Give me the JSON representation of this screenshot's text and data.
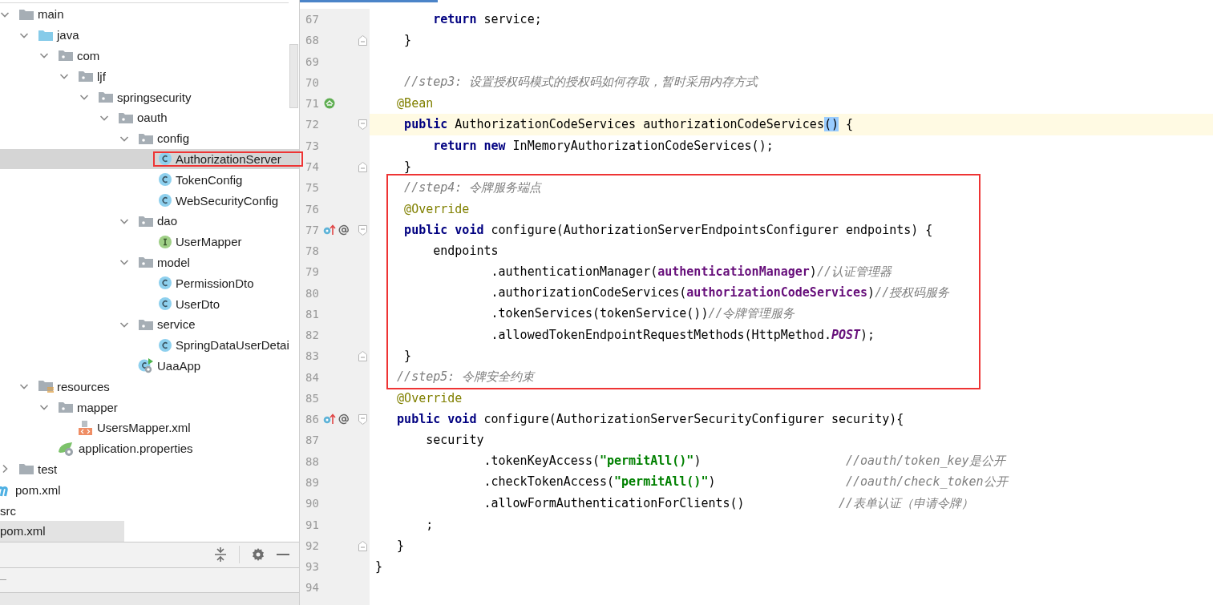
{
  "tree": [
    {
      "label": "main",
      "kind": "folder",
      "expanded": true,
      "selected": false,
      "marked": false,
      "children": [
        {
          "label": "java",
          "kind": "source-folder",
          "expanded": true,
          "selected": false,
          "marked": false,
          "children": [
            {
              "label": "com",
              "kind": "package",
              "expanded": true,
              "selected": false,
              "marked": false,
              "children": [
                {
                  "label": "ljf",
                  "kind": "package",
                  "expanded": true,
                  "selected": false,
                  "marked": false,
                  "children": [
                    {
                      "label": "springsecurity",
                      "kind": "package",
                      "expanded": true,
                      "selected": false,
                      "marked": false,
                      "children": [
                        {
                          "label": "oauth",
                          "kind": "package",
                          "expanded": true,
                          "selected": false,
                          "marked": false,
                          "children": [
                            {
                              "label": "config",
                              "kind": "package",
                              "expanded": true,
                              "selected": false,
                              "marked": false,
                              "children": [
                                {
                                  "label": "AuthorizationServer",
                                  "kind": "class",
                                  "selected": true,
                                  "marked": true
                                },
                                {
                                  "label": "TokenConfig",
                                  "kind": "class",
                                  "selected": false,
                                  "marked": false
                                },
                                {
                                  "label": "WebSecurityConfig",
                                  "kind": "class",
                                  "selected": false,
                                  "marked": false
                                }
                              ]
                            },
                            {
                              "label": "dao",
                              "kind": "package",
                              "expanded": true,
                              "selected": false,
                              "marked": false,
                              "children": [
                                {
                                  "label": "UserMapper",
                                  "kind": "interface",
                                  "selected": false,
                                  "marked": false
                                }
                              ]
                            },
                            {
                              "label": "model",
                              "kind": "package",
                              "expanded": true,
                              "selected": false,
                              "marked": false,
                              "children": [
                                {
                                  "label": "PermissionDto",
                                  "kind": "class",
                                  "selected": false,
                                  "marked": false
                                },
                                {
                                  "label": "UserDto",
                                  "kind": "class",
                                  "selected": false,
                                  "marked": false
                                }
                              ]
                            },
                            {
                              "label": "service",
                              "kind": "package",
                              "expanded": true,
                              "selected": false,
                              "marked": false,
                              "children": [
                                {
                                  "label": "SpringDataUserDetai",
                                  "kind": "class",
                                  "selected": false,
                                  "marked": false
                                }
                              ]
                            },
                            {
                              "label": "UaaApp",
                              "kind": "app",
                              "selected": false,
                              "marked": false
                            }
                          ]
                        }
                      ]
                    }
                  ]
                }
              ]
            }
          ]
        },
        {
          "label": "resources",
          "kind": "resources-folder",
          "expanded": true,
          "selected": false,
          "marked": false,
          "children": [
            {
              "label": "mapper",
              "kind": "package",
              "expanded": true,
              "selected": false,
              "marked": false,
              "children": [
                {
                  "label": "UsersMapper.xml",
                  "kind": "xml",
                  "selected": false,
                  "marked": false
                }
              ]
            },
            {
              "label": "application.properties",
              "kind": "properties",
              "selected": false,
              "marked": false
            }
          ]
        }
      ]
    },
    {
      "label": "test",
      "kind": "folder",
      "expanded": false,
      "selected": false,
      "marked": false
    }
  ],
  "project_items": [
    {
      "label": "pom.xml",
      "kind": "maven",
      "shaded": false
    },
    {
      "label": "src",
      "kind": "plain",
      "shaded": false
    },
    {
      "label": "pom.xml",
      "kind": "plain",
      "shaded": true
    }
  ],
  "code_blocks": [
    {
      "framed": false,
      "lines": [
        {
          "number": "67",
          "code": [
            {
              "kind": "kw",
              "text": "        return"
            },
            {
              "kind": "plain",
              "text": " service;"
            }
          ]
        },
        {
          "number": "68",
          "fold": {
            "kind": "end"
          },
          "code": [
            {
              "kind": "plain",
              "text": "    }"
            }
          ]
        },
        {
          "number": "69"
        },
        {
          "number": "70",
          "code": [
            {
              "kind": "comment",
              "text": "    //step3: 设置授权码模式的授权码如何存取，暂时采用内存方式"
            }
          ]
        },
        {
          "number": "71",
          "gutter_icons": [
            {
              "kind": "bean"
            }
          ],
          "code": [
            {
              "kind": "anno",
              "text": "   @Bean"
            }
          ]
        },
        {
          "number": "72",
          "current": true,
          "fold": {
            "kind": "start"
          },
          "code": [
            {
              "kind": "kw",
              "text": "    public"
            },
            {
              "kind": "plain",
              "text": " AuthorizationCodeServices authorizationCodeServices"
            },
            {
              "kind": "match",
              "text": "()"
            },
            {
              "kind": "plain",
              "text": " {"
            }
          ]
        },
        {
          "number": "73",
          "code": [
            {
              "kind": "kw",
              "text": "        return new"
            },
            {
              "kind": "plain",
              "text": " InMemoryAuthorizationCodeServices();"
            }
          ]
        },
        {
          "number": "74",
          "fold": {
            "kind": "end"
          },
          "code": [
            {
              "kind": "plain",
              "text": "    }"
            }
          ]
        }
      ]
    },
    {
      "framed": true,
      "lines": [
        {
          "number": "75",
          "code": [
            {
              "kind": "comment",
              "text": "    //step4: 令牌服务端点"
            }
          ]
        },
        {
          "number": "76",
          "code": [
            {
              "kind": "anno",
              "text": "    @Override"
            }
          ]
        },
        {
          "number": "77",
          "fold": {
            "kind": "start"
          },
          "gutter_icons": [
            {
              "kind": "override"
            },
            {
              "kind": "implements"
            }
          ],
          "code": [
            {
              "kind": "kw",
              "text": "    public void"
            },
            {
              "kind": "plain",
              "text": " configure(AuthorizationServerEndpointsConfigurer endpoints) {"
            }
          ]
        },
        {
          "number": "78",
          "code": [
            {
              "kind": "plain",
              "text": "        endpoints"
            }
          ]
        },
        {
          "number": "79",
          "code": [
            {
              "kind": "plain",
              "text": "                .authenticationManager("
            },
            {
              "kind": "field",
              "text": "authenticationManager"
            },
            {
              "kind": "plain",
              "text": ")"
            },
            {
              "kind": "comment",
              "text": "//认证管理器"
            }
          ]
        },
        {
          "number": "80",
          "code": [
            {
              "kind": "plain",
              "text": "                .authorizationCodeServices("
            },
            {
              "kind": "field",
              "text": "authorizationCodeServices"
            },
            {
              "kind": "plain",
              "text": ")"
            },
            {
              "kind": "comment",
              "text": "//授权码服务"
            }
          ]
        },
        {
          "number": "81",
          "code": [
            {
              "kind": "plain",
              "text": "                .tokenServices(tokenService())"
            },
            {
              "kind": "comment",
              "text": "//令牌管理服务"
            }
          ]
        },
        {
          "number": "82",
          "code": [
            {
              "kind": "plain",
              "text": "                .allowedTokenEndpointRequestMethods(HttpMethod."
            },
            {
              "kind": "const",
              "text": "POST"
            },
            {
              "kind": "plain",
              "text": ");"
            }
          ]
        },
        {
          "number": "83",
          "fold": {
            "kind": "end"
          },
          "code": [
            {
              "kind": "plain",
              "text": "    }"
            }
          ]
        },
        {
          "number": "84",
          "code": [
            {
              "kind": "comment",
              "text": "   //step5: 令牌安全约束"
            }
          ]
        }
      ]
    },
    {
      "framed": false,
      "lines": [
        {
          "number": "85",
          "code": [
            {
              "kind": "anno",
              "text": "   @Override"
            }
          ]
        },
        {
          "number": "86",
          "fold": {
            "kind": "start"
          },
          "gutter_icons": [
            {
              "kind": "override"
            },
            {
              "kind": "implements"
            }
          ],
          "code": [
            {
              "kind": "kw",
              "text": "   public void"
            },
            {
              "kind": "plain",
              "text": " configure(AuthorizationServerSecurityConfigurer security){"
            }
          ]
        },
        {
          "number": "87",
          "code": [
            {
              "kind": "plain",
              "text": "       security"
            }
          ]
        },
        {
          "number": "88",
          "code": [
            {
              "kind": "plain",
              "text": "               .tokenKeyAccess("
            },
            {
              "kind": "str",
              "text": "\"permitAll()\""
            },
            {
              "kind": "plain",
              "text": ")                    "
            },
            {
              "kind": "comment",
              "text": "//oauth/token_key是公开"
            }
          ]
        },
        {
          "number": "89",
          "code": [
            {
              "kind": "plain",
              "text": "               .checkTokenAccess("
            },
            {
              "kind": "str",
              "text": "\"permitAll()\""
            },
            {
              "kind": "plain",
              "text": ")                  "
            },
            {
              "kind": "comment",
              "text": "//oauth/check_token公开"
            }
          ]
        },
        {
          "number": "90",
          "code": [
            {
              "kind": "plain",
              "text": "               .allowFormAuthenticationForClients()             "
            },
            {
              "kind": "comment",
              "text": "//表单认证（申请令牌）"
            }
          ]
        },
        {
          "number": "91",
          "code": [
            {
              "kind": "plain",
              "text": "       ;"
            }
          ]
        },
        {
          "number": "92",
          "fold": {
            "kind": "end"
          },
          "code": [
            {
              "kind": "plain",
              "text": "   }"
            }
          ]
        },
        {
          "number": "93",
          "code": [
            {
              "kind": "plain",
              "text": "}"
            }
          ]
        },
        {
          "number": "94"
        }
      ]
    }
  ]
}
